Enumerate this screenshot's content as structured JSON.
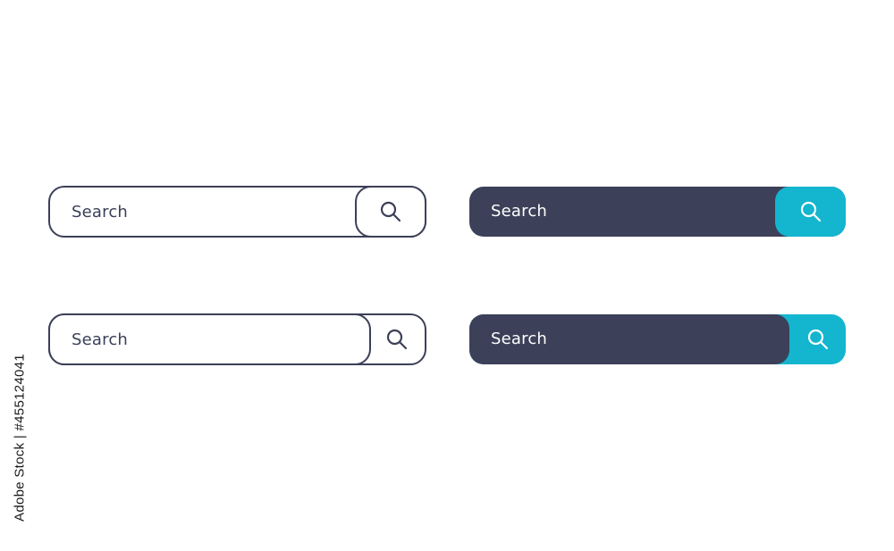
{
  "search_bars": [
    {
      "style": "outline-with-outlined-button",
      "placeholder": "Search",
      "button_icon": "search-icon",
      "border_color": "#3c4058",
      "text_color": "#3c4058",
      "background_color": "#ffffff"
    },
    {
      "style": "outline-with-outlined-field",
      "placeholder": "Search",
      "button_icon": "search-icon",
      "border_color": "#3c4058",
      "text_color": "#3c4058",
      "background_color": "#ffffff"
    },
    {
      "style": "filled-dark-with-cyan-button",
      "placeholder": "Search",
      "button_icon": "search-icon",
      "field_color": "#3c4058",
      "button_color": "#13b5cf",
      "text_color": "#ffffff"
    },
    {
      "style": "filled-dark-field-on-cyan",
      "placeholder": "Search",
      "button_icon": "search-icon",
      "field_color": "#3c4058",
      "button_color": "#13b5cf",
      "text_color": "#ffffff"
    }
  ],
  "watermark": {
    "stock_id": "Adobe Stock | #455124041"
  }
}
